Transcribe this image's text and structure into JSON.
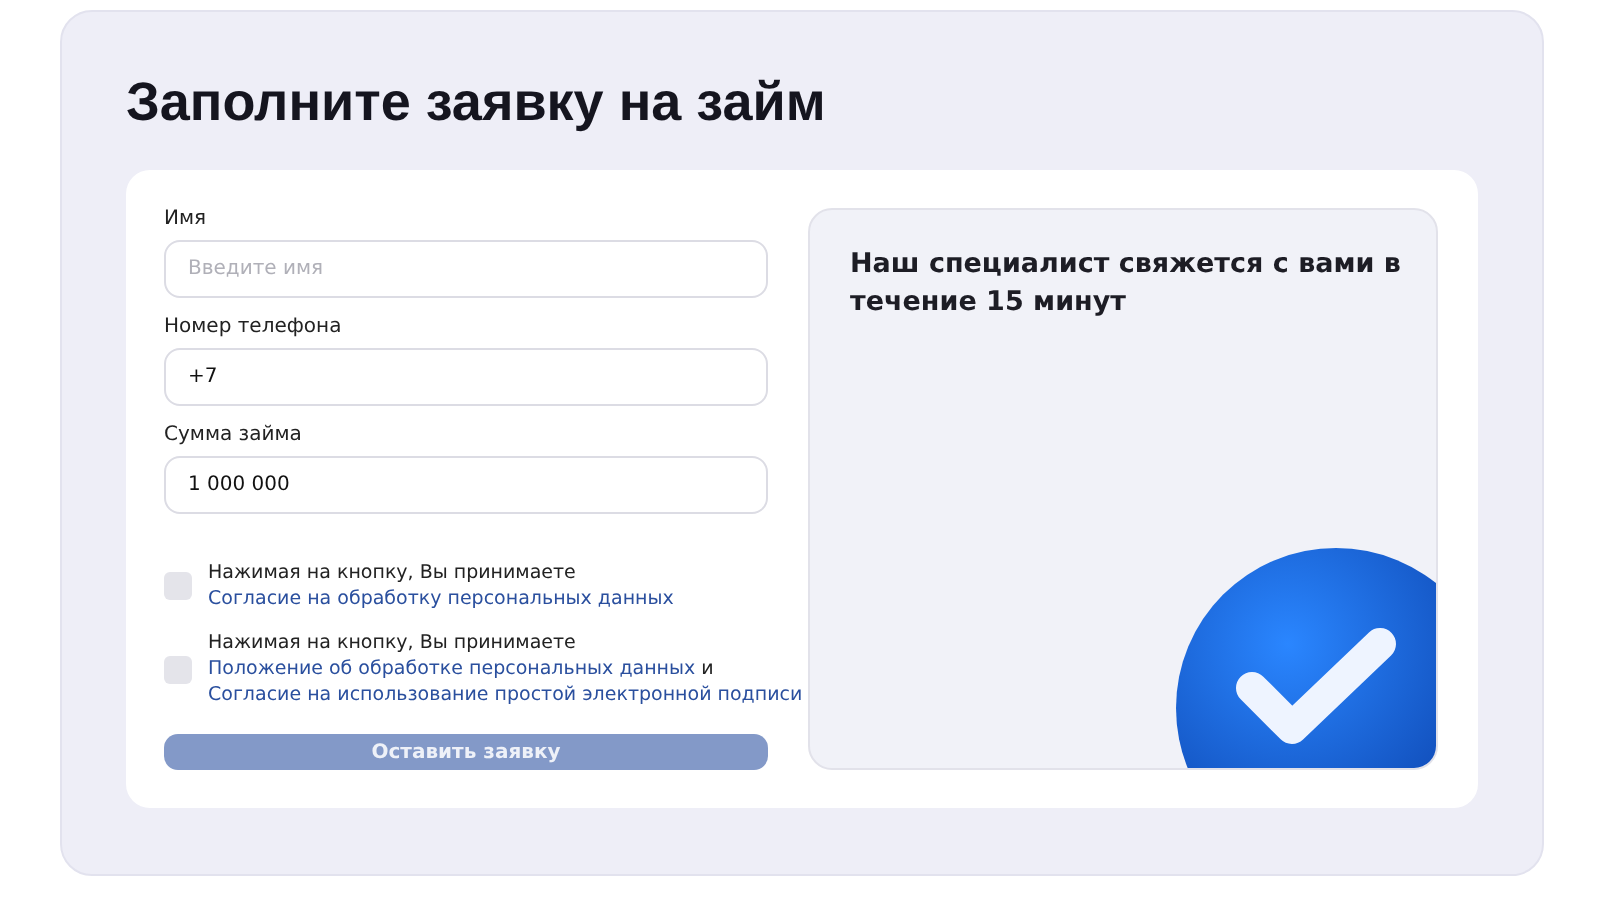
{
  "title": "Заполните заявку на займ",
  "fields": [
    {
      "label": "Имя",
      "placeholder": "Введите имя"
    },
    {
      "label": "Номер телефона",
      "value": "+7"
    },
    {
      "label": "Сумма займа",
      "value": "1 000 000"
    }
  ],
  "consents": [
    {
      "checked": false,
      "parts": [
        {
          "text": "Нажимая на кнопку, Вы принимаете ",
          "link": false
        },
        {
          "text": "Согласие на обработку персональных данных",
          "link": true
        }
      ]
    },
    {
      "checked": false,
      "parts": [
        {
          "text": "Нажимая на кнопку, Вы принимаете ",
          "link": false
        },
        {
          "text": "Положение об обработке персональных данных",
          "link": true
        },
        {
          "text": " и ",
          "link": false
        },
        {
          "text": "Согласие на использование простой электронной подписи",
          "link": true
        }
      ]
    }
  ],
  "submit": {
    "label": "Оставить заявку",
    "disabled": true
  },
  "info": {
    "text": "Наш специалист свяжется с вами в течение 15 минут"
  }
}
